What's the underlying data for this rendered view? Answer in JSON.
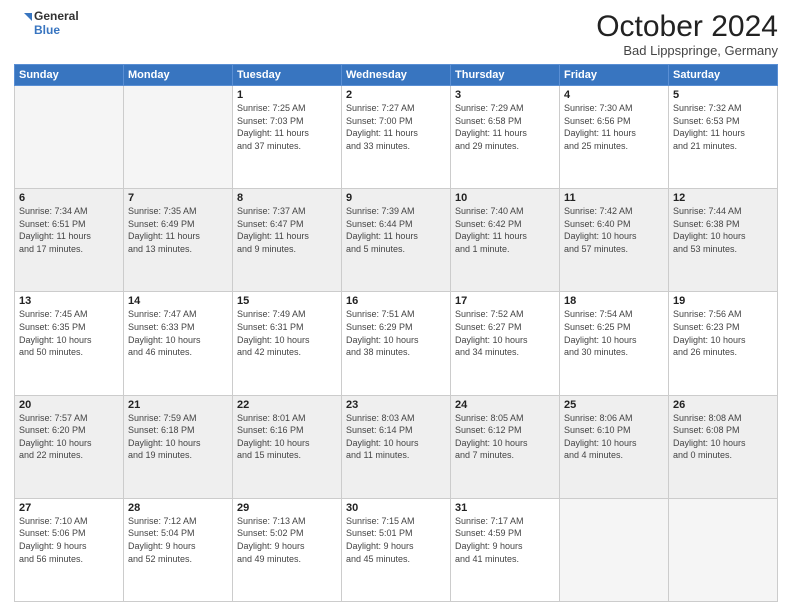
{
  "header": {
    "logo_line1": "General",
    "logo_line2": "Blue",
    "month": "October 2024",
    "location": "Bad Lippspringe, Germany"
  },
  "days_of_week": [
    "Sunday",
    "Monday",
    "Tuesday",
    "Wednesday",
    "Thursday",
    "Friday",
    "Saturday"
  ],
  "weeks": [
    [
      {
        "day": "",
        "info": ""
      },
      {
        "day": "",
        "info": ""
      },
      {
        "day": "1",
        "info": "Sunrise: 7:25 AM\nSunset: 7:03 PM\nDaylight: 11 hours\nand 37 minutes."
      },
      {
        "day": "2",
        "info": "Sunrise: 7:27 AM\nSunset: 7:00 PM\nDaylight: 11 hours\nand 33 minutes."
      },
      {
        "day": "3",
        "info": "Sunrise: 7:29 AM\nSunset: 6:58 PM\nDaylight: 11 hours\nand 29 minutes."
      },
      {
        "day": "4",
        "info": "Sunrise: 7:30 AM\nSunset: 6:56 PM\nDaylight: 11 hours\nand 25 minutes."
      },
      {
        "day": "5",
        "info": "Sunrise: 7:32 AM\nSunset: 6:53 PM\nDaylight: 11 hours\nand 21 minutes."
      }
    ],
    [
      {
        "day": "6",
        "info": "Sunrise: 7:34 AM\nSunset: 6:51 PM\nDaylight: 11 hours\nand 17 minutes."
      },
      {
        "day": "7",
        "info": "Sunrise: 7:35 AM\nSunset: 6:49 PM\nDaylight: 11 hours\nand 13 minutes."
      },
      {
        "day": "8",
        "info": "Sunrise: 7:37 AM\nSunset: 6:47 PM\nDaylight: 11 hours\nand 9 minutes."
      },
      {
        "day": "9",
        "info": "Sunrise: 7:39 AM\nSunset: 6:44 PM\nDaylight: 11 hours\nand 5 minutes."
      },
      {
        "day": "10",
        "info": "Sunrise: 7:40 AM\nSunset: 6:42 PM\nDaylight: 11 hours\nand 1 minute."
      },
      {
        "day": "11",
        "info": "Sunrise: 7:42 AM\nSunset: 6:40 PM\nDaylight: 10 hours\nand 57 minutes."
      },
      {
        "day": "12",
        "info": "Sunrise: 7:44 AM\nSunset: 6:38 PM\nDaylight: 10 hours\nand 53 minutes."
      }
    ],
    [
      {
        "day": "13",
        "info": "Sunrise: 7:45 AM\nSunset: 6:35 PM\nDaylight: 10 hours\nand 50 minutes."
      },
      {
        "day": "14",
        "info": "Sunrise: 7:47 AM\nSunset: 6:33 PM\nDaylight: 10 hours\nand 46 minutes."
      },
      {
        "day": "15",
        "info": "Sunrise: 7:49 AM\nSunset: 6:31 PM\nDaylight: 10 hours\nand 42 minutes."
      },
      {
        "day": "16",
        "info": "Sunrise: 7:51 AM\nSunset: 6:29 PM\nDaylight: 10 hours\nand 38 minutes."
      },
      {
        "day": "17",
        "info": "Sunrise: 7:52 AM\nSunset: 6:27 PM\nDaylight: 10 hours\nand 34 minutes."
      },
      {
        "day": "18",
        "info": "Sunrise: 7:54 AM\nSunset: 6:25 PM\nDaylight: 10 hours\nand 30 minutes."
      },
      {
        "day": "19",
        "info": "Sunrise: 7:56 AM\nSunset: 6:23 PM\nDaylight: 10 hours\nand 26 minutes."
      }
    ],
    [
      {
        "day": "20",
        "info": "Sunrise: 7:57 AM\nSunset: 6:20 PM\nDaylight: 10 hours\nand 22 minutes."
      },
      {
        "day": "21",
        "info": "Sunrise: 7:59 AM\nSunset: 6:18 PM\nDaylight: 10 hours\nand 19 minutes."
      },
      {
        "day": "22",
        "info": "Sunrise: 8:01 AM\nSunset: 6:16 PM\nDaylight: 10 hours\nand 15 minutes."
      },
      {
        "day": "23",
        "info": "Sunrise: 8:03 AM\nSunset: 6:14 PM\nDaylight: 10 hours\nand 11 minutes."
      },
      {
        "day": "24",
        "info": "Sunrise: 8:05 AM\nSunset: 6:12 PM\nDaylight: 10 hours\nand 7 minutes."
      },
      {
        "day": "25",
        "info": "Sunrise: 8:06 AM\nSunset: 6:10 PM\nDaylight: 10 hours\nand 4 minutes."
      },
      {
        "day": "26",
        "info": "Sunrise: 8:08 AM\nSunset: 6:08 PM\nDaylight: 10 hours\nand 0 minutes."
      }
    ],
    [
      {
        "day": "27",
        "info": "Sunrise: 7:10 AM\nSunset: 5:06 PM\nDaylight: 9 hours\nand 56 minutes."
      },
      {
        "day": "28",
        "info": "Sunrise: 7:12 AM\nSunset: 5:04 PM\nDaylight: 9 hours\nand 52 minutes."
      },
      {
        "day": "29",
        "info": "Sunrise: 7:13 AM\nSunset: 5:02 PM\nDaylight: 9 hours\nand 49 minutes."
      },
      {
        "day": "30",
        "info": "Sunrise: 7:15 AM\nSunset: 5:01 PM\nDaylight: 9 hours\nand 45 minutes."
      },
      {
        "day": "31",
        "info": "Sunrise: 7:17 AM\nSunset: 4:59 PM\nDaylight: 9 hours\nand 41 minutes."
      },
      {
        "day": "",
        "info": ""
      },
      {
        "day": "",
        "info": ""
      }
    ]
  ]
}
